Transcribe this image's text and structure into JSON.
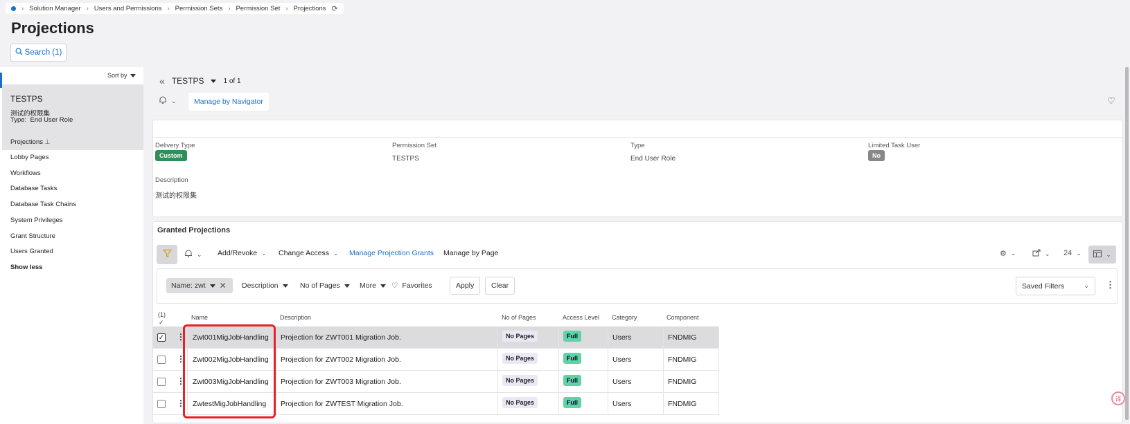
{
  "breadcrumb": [
    "Solution Manager",
    "Users and Permissions",
    "Permission Sets",
    "Permission Set",
    "Projections"
  ],
  "page_title": "Projections",
  "search_button": "Search (1)",
  "sidebar": {
    "sort_label": "Sort by",
    "card": {
      "title": "TESTPS",
      "subtitle": "测试的权限集",
      "type_label": "Type:",
      "type_value": "End User Role"
    },
    "items": [
      {
        "label": "Projections",
        "selected": true
      },
      {
        "label": "Lobby Pages"
      },
      {
        "label": "Workflows"
      },
      {
        "label": "Database Tasks"
      },
      {
        "label": "Database Task Chains"
      },
      {
        "label": "System Privileges"
      },
      {
        "label": "Grant Structure"
      },
      {
        "label": "Users Granted"
      }
    ],
    "show_less": "Show less"
  },
  "record_header": {
    "name": "TESTPS",
    "count": "1 of 1",
    "manage_by_navigator": "Manage by Navigator"
  },
  "details": {
    "delivery_type_label": "Delivery Type",
    "delivery_type_value": "Custom",
    "permission_set_label": "Permission Set",
    "permission_set_value": "TESTPS",
    "type_label": "Type",
    "type_value": "End User Role",
    "limited_task_user_label": "Limited Task User",
    "limited_task_user_value": "No",
    "description_label": "Description",
    "description_value": "测试的权限集"
  },
  "granted": {
    "title": "Granted Projections",
    "toolbar": {
      "add_revoke": "Add/Revoke",
      "change_access": "Change Access",
      "manage_projection_grants": "Manage Projection Grants",
      "manage_by_page": "Manage by Page",
      "page_size": "24"
    },
    "filters": {
      "name_chip": "Name: zwt",
      "description": "Description",
      "no_of_pages": "No of Pages",
      "more": "More",
      "favorites": "Favorites",
      "apply": "Apply",
      "clear": "Clear",
      "saved_filters": "Saved Filters"
    },
    "selected_count": "(1)",
    "columns": [
      "Name",
      "Description",
      "No of Pages",
      "Access Level",
      "Category",
      "Component"
    ],
    "rows": [
      {
        "name": "Zwt001MigJobHandling",
        "description": "Projection for ZWT001 Migration Job.",
        "pages": "No Pages",
        "access": "Full",
        "category": "Users",
        "component": "FNDMIG",
        "selected": true
      },
      {
        "name": "Zwt002MigJobHandling",
        "description": "Projection for ZWT002 Migration Job.",
        "pages": "No Pages",
        "access": "Full",
        "category": "Users",
        "component": "FNDMIG",
        "selected": false
      },
      {
        "name": "Zwt003MigJobHandling",
        "description": "Projection for ZWT003 Migration Job.",
        "pages": "No Pages",
        "access": "Full",
        "category": "Users",
        "component": "FNDMIG",
        "selected": false
      },
      {
        "name": "ZwtestMigJobHandling",
        "description": "Projection for ZWTEST Migration Job.",
        "pages": "No Pages",
        "access": "Full",
        "category": "Users",
        "component": "FNDMIG",
        "selected": false
      }
    ]
  },
  "colors": {
    "accent": "#1a6fc9",
    "highlight_box": "#e8202a",
    "custom_badge": "#2f8f5a",
    "full_badge": "#5fd3a4"
  }
}
